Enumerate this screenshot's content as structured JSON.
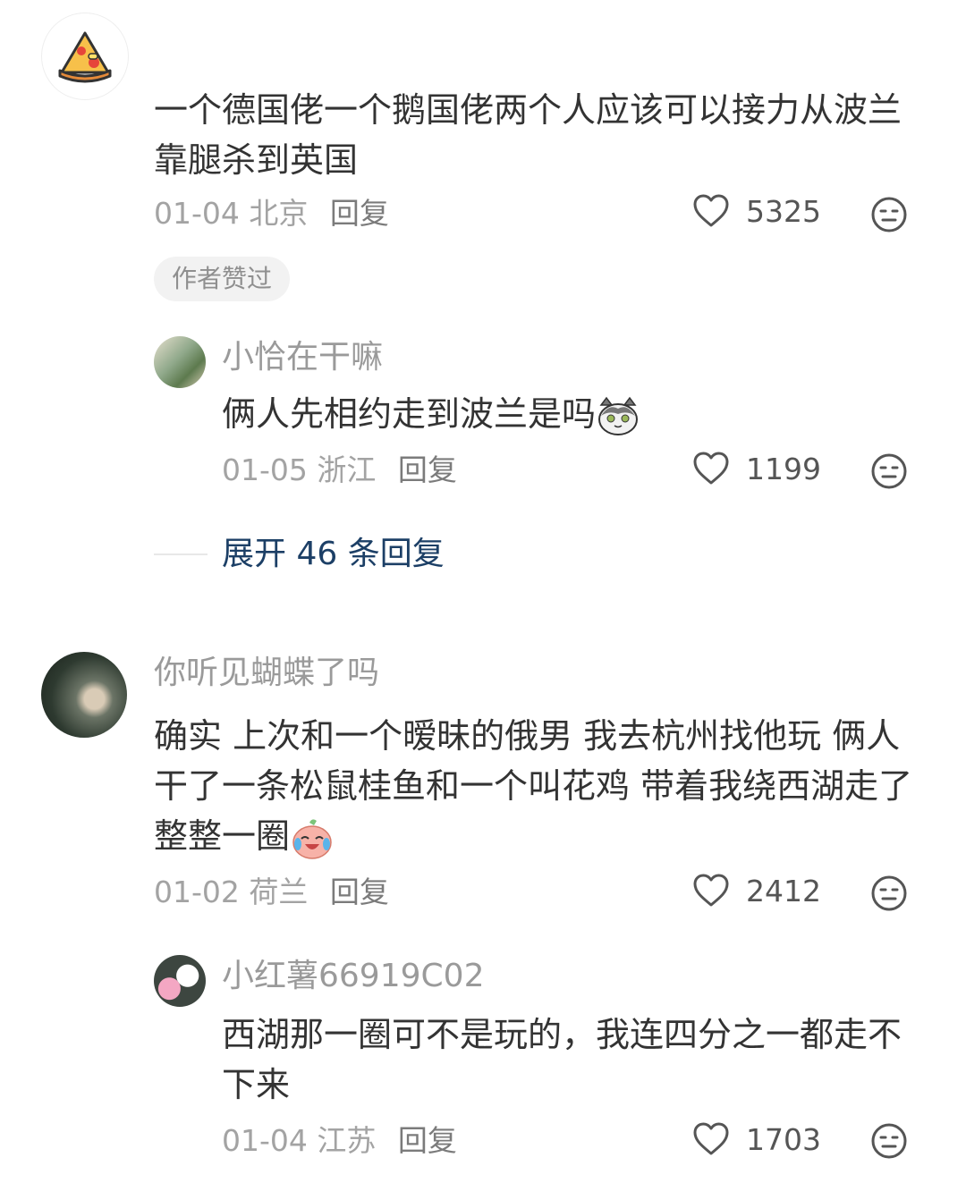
{
  "comments": [
    {
      "avatar_icon": "pizza-icon",
      "text": "一个德国佬一个鹅国佬两个人应该可以接力从波兰靠腿杀到英国",
      "date": "01-04",
      "location": "北京",
      "reply_label": "回复",
      "likes": "5325",
      "author_liked_badge": "作者赞过",
      "reply": {
        "username": "小恰在干嘛",
        "text": "俩人先相约走到波兰是吗",
        "emoji_icon": "cat-emoji-icon",
        "date": "01-05",
        "location": "浙江",
        "reply_label": "回复",
        "likes": "1199"
      },
      "expand_label": "展开 46 条回复"
    },
    {
      "username": "你听见蝴蝶了吗",
      "text": "确实 上次和一个暧昧的俄男 我去杭州找他玩 俩人干了一条松鼠桂鱼和一个叫花鸡 带着我绕西湖走了整整一圈",
      "emoji_icon": "laugh-cry-peach-icon",
      "date": "01-02",
      "location": "荷兰",
      "reply_label": "回复",
      "likes": "2412",
      "reply": {
        "username": "小红薯66919C02",
        "text": "西湖那一圈可不是玩的，我连四分之一都走不下来",
        "date": "01-04",
        "location": "江苏",
        "reply_label": "回复",
        "likes": "1703"
      }
    }
  ],
  "colors": {
    "link_blue": "#1c3f66",
    "meta_gray": "#a3a3a3",
    "text_dark": "#333333"
  }
}
